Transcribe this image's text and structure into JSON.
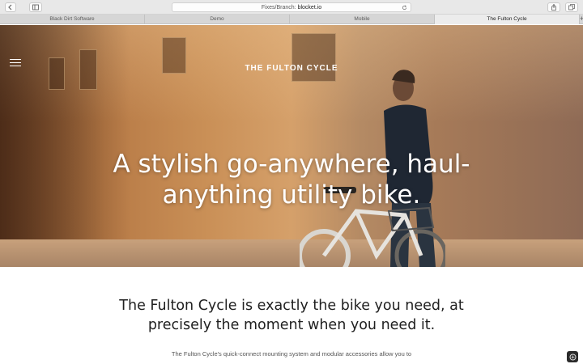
{
  "browser": {
    "url_prefix": "Fixes/Branch:",
    "url_host": "blocket.io",
    "tabs": [
      {
        "label": "Black Dirt Software",
        "active": false
      },
      {
        "label": "Demo",
        "active": false
      },
      {
        "label": "Mobile",
        "active": false
      },
      {
        "label": "The Fulton Cycle",
        "active": true
      }
    ],
    "add_tab_label": "+"
  },
  "hero": {
    "brand": "THE FULTON CYCLE",
    "headline": "A stylish go-anywhere, haul-anything utility bike."
  },
  "content": {
    "title": "The Fulton Cycle is exactly the bike you need, at precisely the moment when you need it.",
    "paragraph": "The Fulton Cycle's quick-connect mounting system and modular accessories allow you to"
  },
  "icons": {
    "back": "chevron-left-icon",
    "sidebar": "sidebar-icon",
    "share": "share-icon",
    "tabs": "tabs-icon",
    "reload": "reload-icon",
    "menu": "hamburger-menu-icon",
    "corner": "bug-icon"
  },
  "colors": {
    "hero_text": "#ffffff",
    "content_text": "#1f1f1f",
    "chrome_bg": "#e8e8e8"
  }
}
